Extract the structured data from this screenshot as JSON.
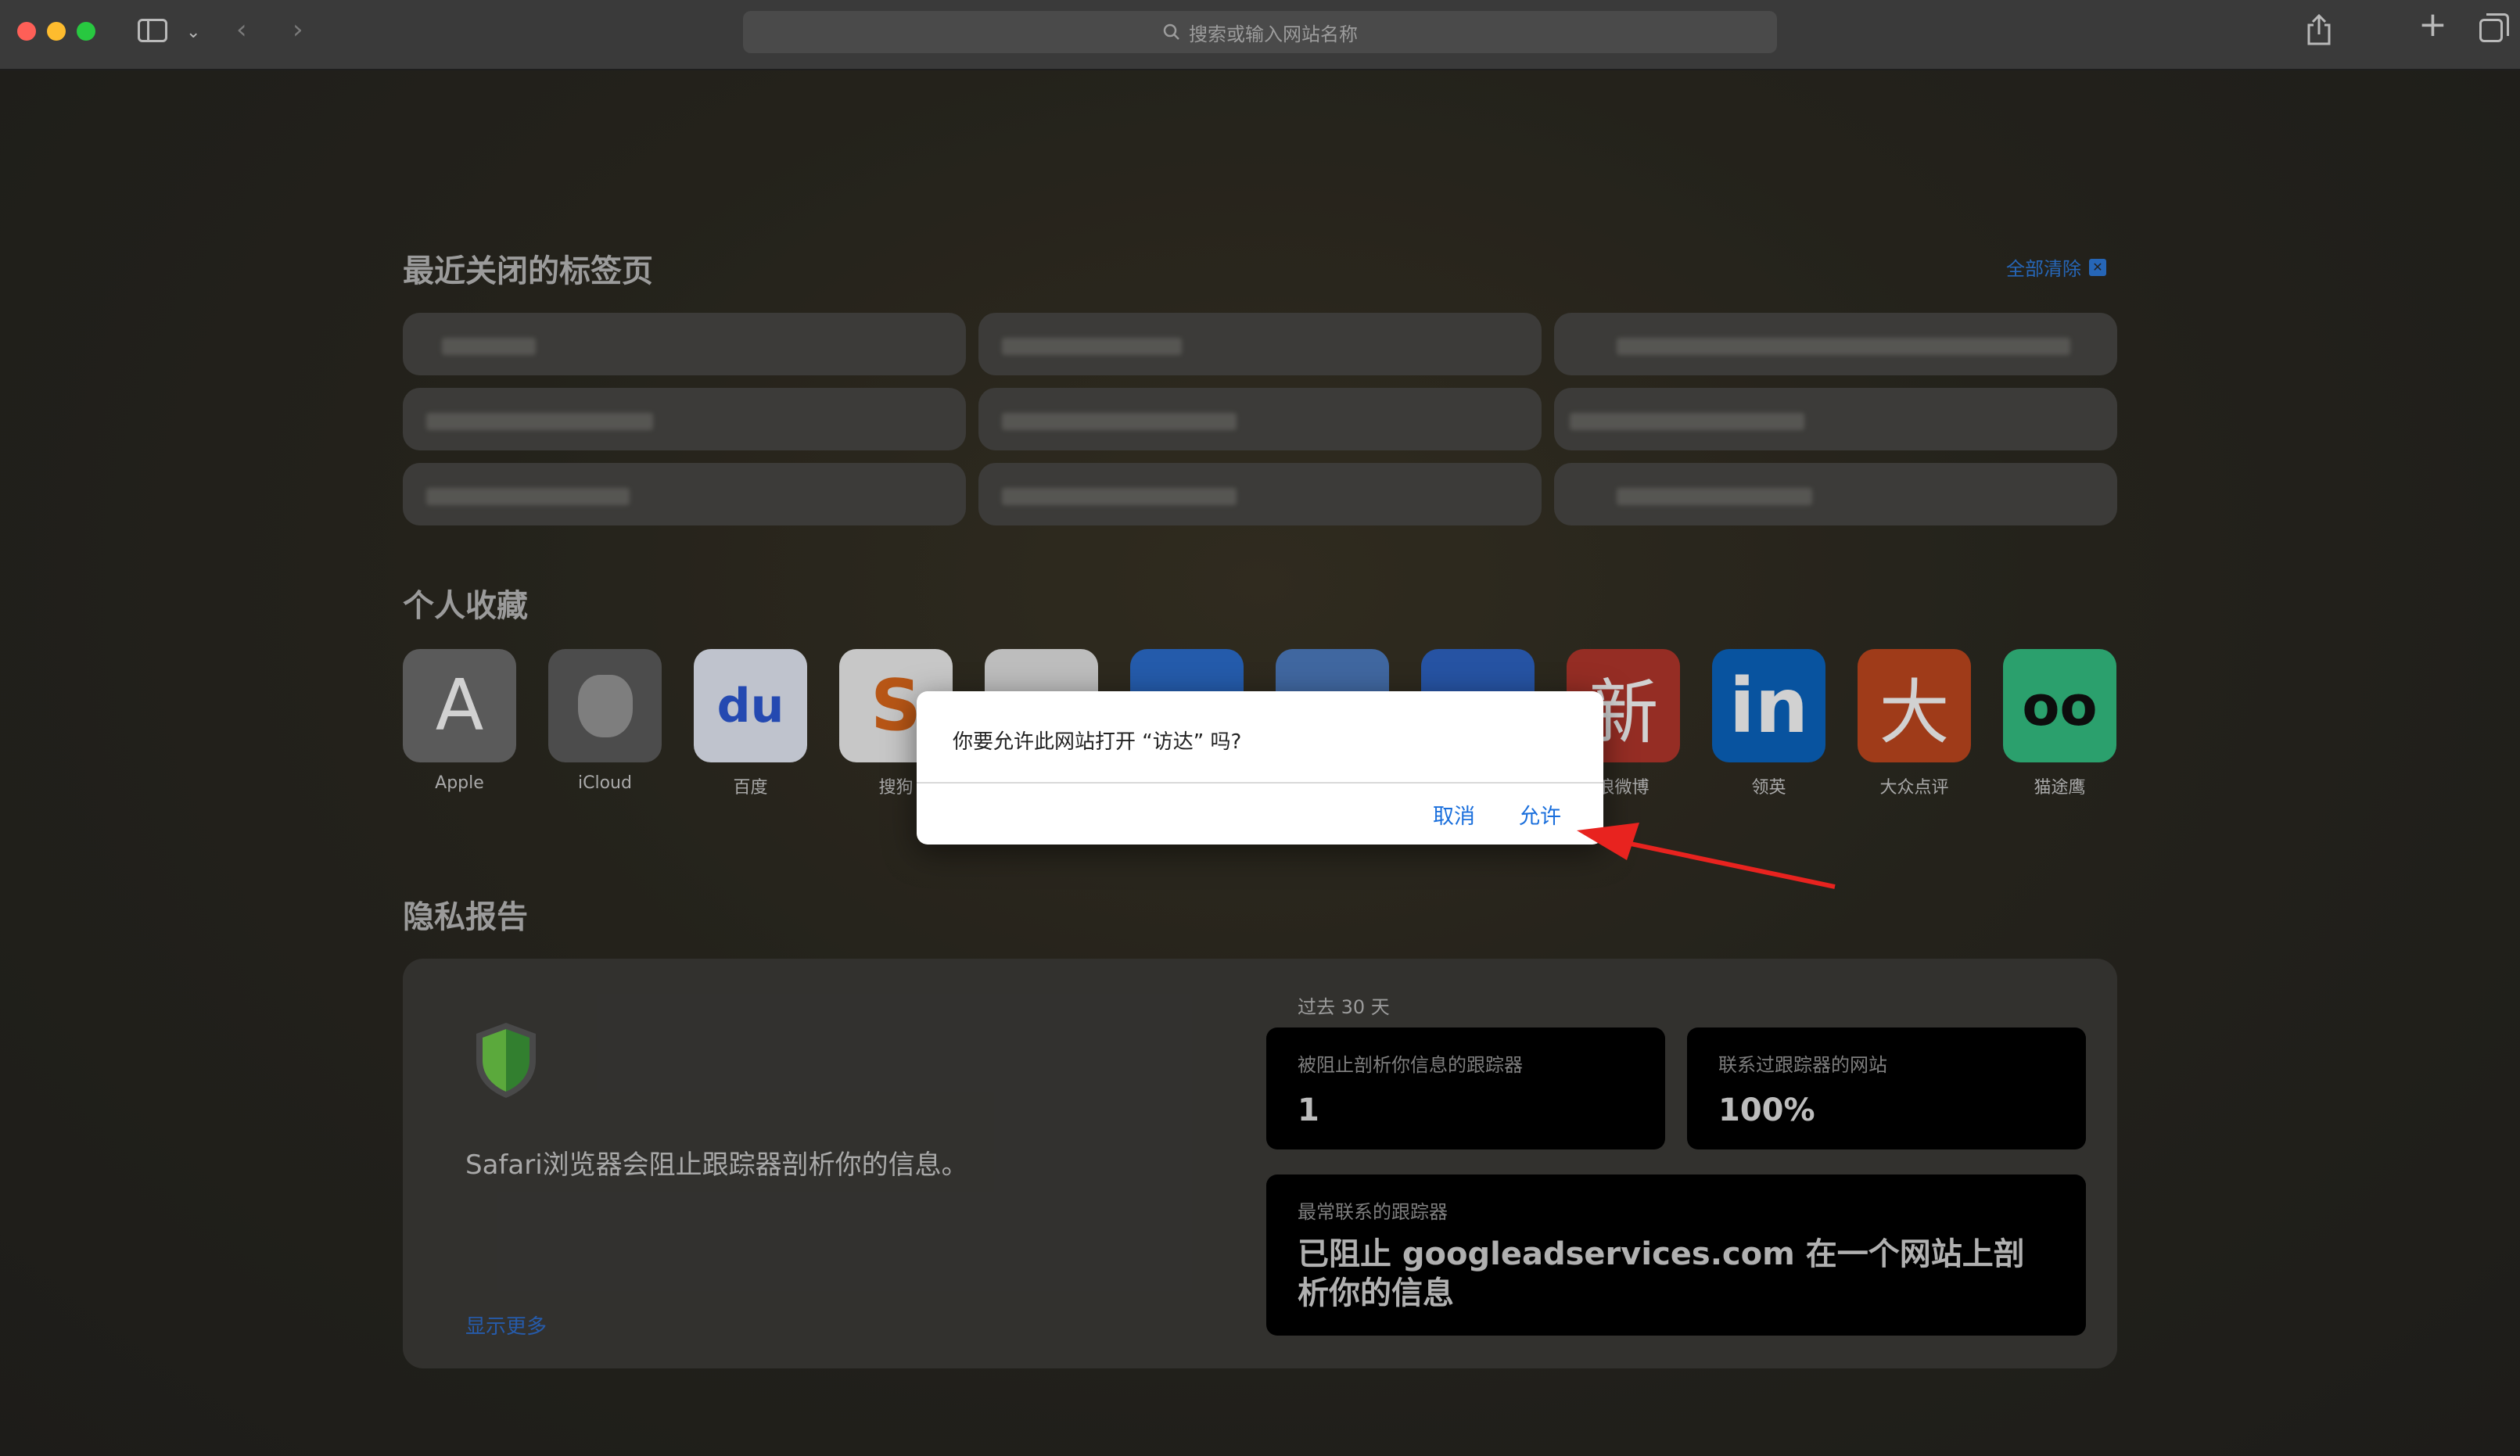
{
  "toolbar": {
    "address_placeholder": "搜索或输入网站名称"
  },
  "recent": {
    "title": "最近关闭的标签页",
    "clear_all": "全部清除"
  },
  "favorites": {
    "title": "个人收藏",
    "items": [
      {
        "label": "Apple",
        "glyph": "A",
        "bg": "#6e6e6e"
      },
      {
        "label": "iCloud",
        "glyph": "",
        "bg": "#5d5d5d"
      },
      {
        "label": "百度",
        "glyph": "du",
        "bg": "#e9eefb"
      },
      {
        "label": "搜狗",
        "glyph": "S",
        "bg": "#f3f3f3"
      },
      {
        "label": "",
        "glyph": "",
        "bg": "#e7e7e7"
      },
      {
        "label": "",
        "glyph": "",
        "bg": "#2d6fd1"
      },
      {
        "label": "",
        "glyph": "",
        "bg": "#4f7ec4"
      },
      {
        "label": "",
        "glyph": "",
        "bg": "#2f66c7"
      },
      {
        "label": "浪微博",
        "glyph": "新",
        "bg": "#b6372d"
      },
      {
        "label": "领英",
        "glyph": "in",
        "bg": "#0a66c2"
      },
      {
        "label": "大众点评",
        "glyph": "大",
        "bg": "#c3491f"
      },
      {
        "label": "猫途鹰",
        "glyph": "oo",
        "bg": "#35c486"
      }
    ]
  },
  "privacy": {
    "title": "隐私报告",
    "description": "Safari浏览器会阻止跟踪器剖析你的信息。",
    "show_more": "显示更多",
    "period": "过去 30 天",
    "blocked_label": "被阻止剖析你信息的跟踪器",
    "blocked_value": "1",
    "contacted_label": "联系过跟踪器的网站",
    "contacted_value": "100%",
    "top_label": "最常联系的跟踪器",
    "top_value": "已阻止 googleadservices.com 在一个网站上剖析你的信息"
  },
  "dialog": {
    "message": "你要允许此网站打开 “访达” 吗?",
    "cancel": "取消",
    "allow": "允许"
  },
  "colors": {
    "accent": "#1a6fdc",
    "arrow": "#e8231f"
  }
}
